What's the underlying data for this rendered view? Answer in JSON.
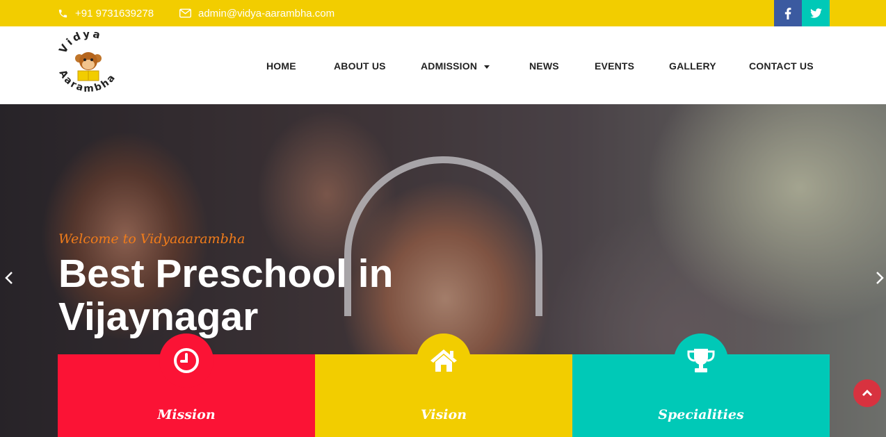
{
  "topbar": {
    "phone": "+91 9731639278",
    "email": "admin@vidya-aarambha.com",
    "social": [
      {
        "name": "facebook",
        "icon": "facebook-icon"
      },
      {
        "name": "twitter",
        "icon": "twitter-icon"
      }
    ]
  },
  "logo": {
    "line1": "Vidya",
    "line2": "Aarambha"
  },
  "nav": {
    "items": [
      {
        "label": "HOME"
      },
      {
        "label": "ABOUT US"
      },
      {
        "label": "ADMISSION",
        "has_dropdown": true
      },
      {
        "label": "NEWS"
      },
      {
        "label": "EVENTS"
      },
      {
        "label": "GALLERY"
      },
      {
        "label": "CONTACT US"
      }
    ]
  },
  "hero": {
    "welcome": "Welcome to Vidyaaarambha",
    "title": "Best Preschool in Vijaynagar"
  },
  "features": [
    {
      "label": "Mission",
      "icon": "clock-icon",
      "color": "#fb1335"
    },
    {
      "label": "Vision",
      "icon": "home-icon",
      "color": "#f2cd00"
    },
    {
      "label": "Specialities",
      "icon": "trophy-icon",
      "color": "#00c9b7"
    }
  ],
  "colors": {
    "yellow": "#f2cd00",
    "red": "#fb1335",
    "teal": "#00c9b7",
    "facebook": "#3b5aa0",
    "accent_orange": "#f07c1b"
  }
}
